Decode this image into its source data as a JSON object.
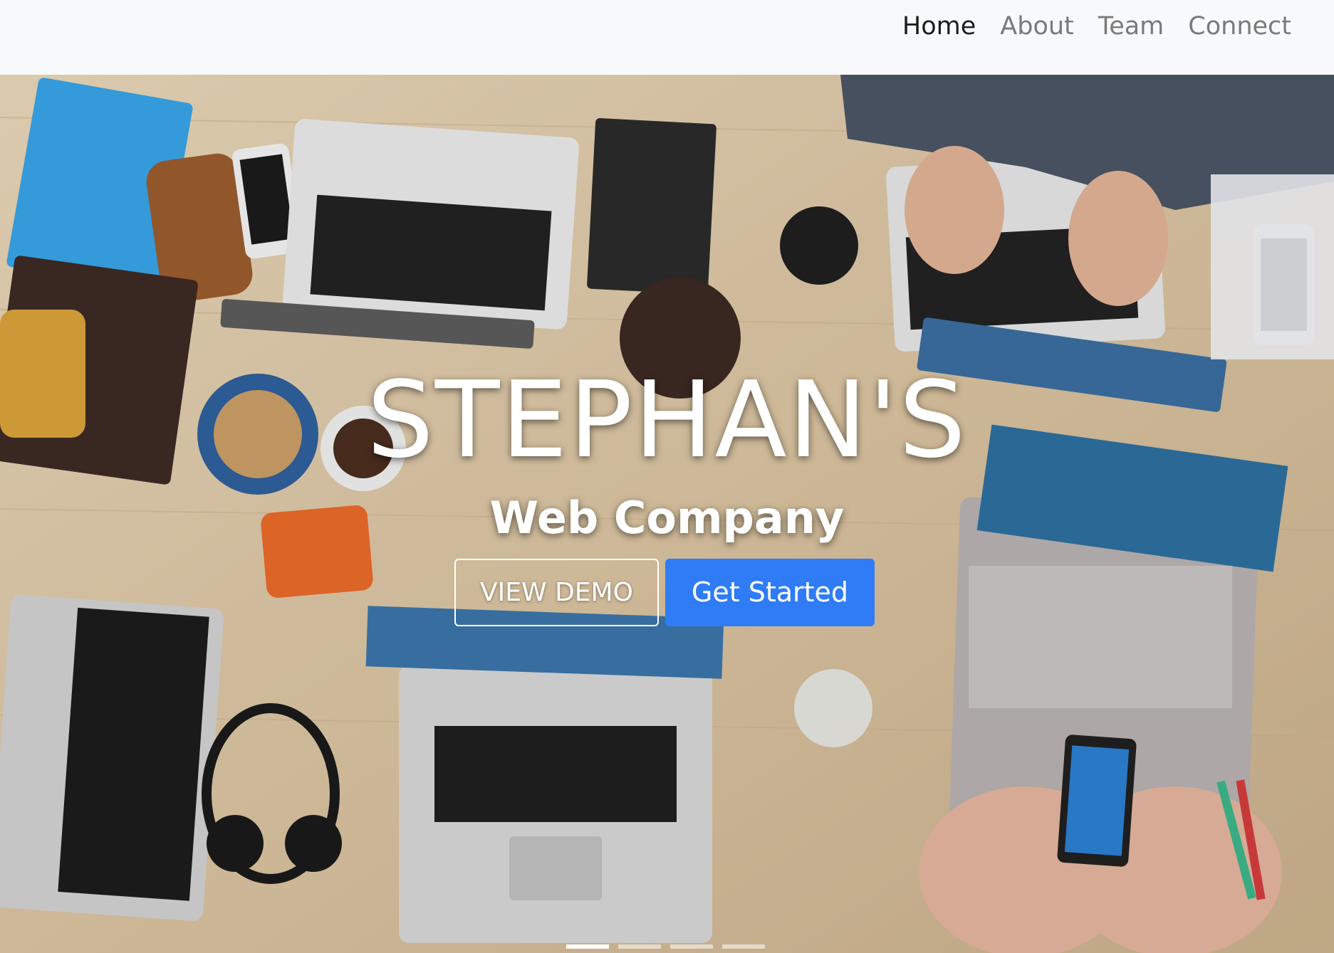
{
  "nav": {
    "items": [
      {
        "label": "Home",
        "active": true
      },
      {
        "label": "About",
        "active": false
      },
      {
        "label": "Team",
        "active": false
      },
      {
        "label": "Connect",
        "active": false
      }
    ]
  },
  "hero": {
    "title": "STEPHAN'S",
    "subtitle": "Web Company",
    "demo_button": "VIEW DEMO",
    "start_button": "Get Started",
    "background_description_icon": "office-desk-laptops-photo",
    "slides_count": 4,
    "active_slide": 1
  },
  "colors": {
    "nav_background": "#f8f9fa",
    "nav_active": "#1d1d1d",
    "nav_inactive": "#7a7a7a",
    "primary_button": "#2f7cf6"
  }
}
